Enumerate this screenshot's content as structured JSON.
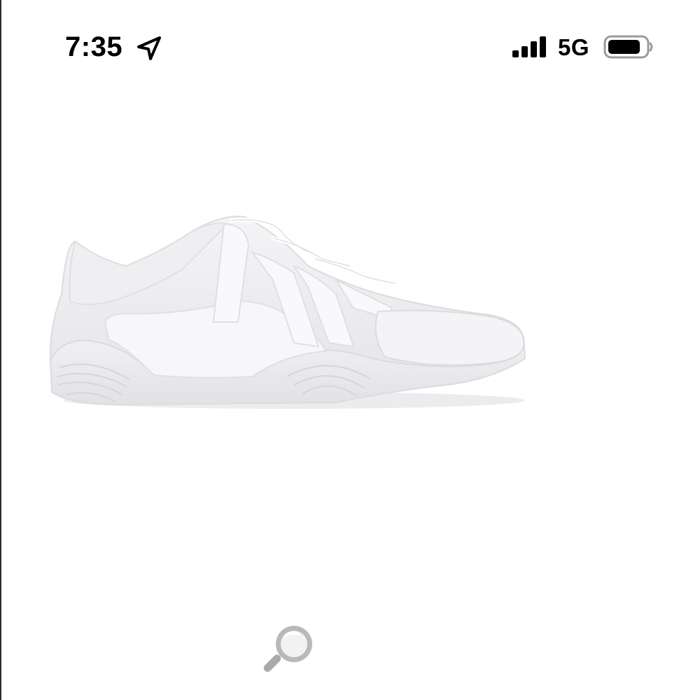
{
  "status_bar": {
    "time": "7:35",
    "network": "5G",
    "icons": [
      "location-arrow-icon",
      "cellular-signal-icon",
      "battery-icon"
    ]
  },
  "content": {
    "image": "white-cheer-sneaker",
    "zoom_icon": "magnifier-icon"
  },
  "colors": {
    "background": "#ffffff",
    "text": "#000000",
    "zoom_icon": "#b7b7b7"
  }
}
